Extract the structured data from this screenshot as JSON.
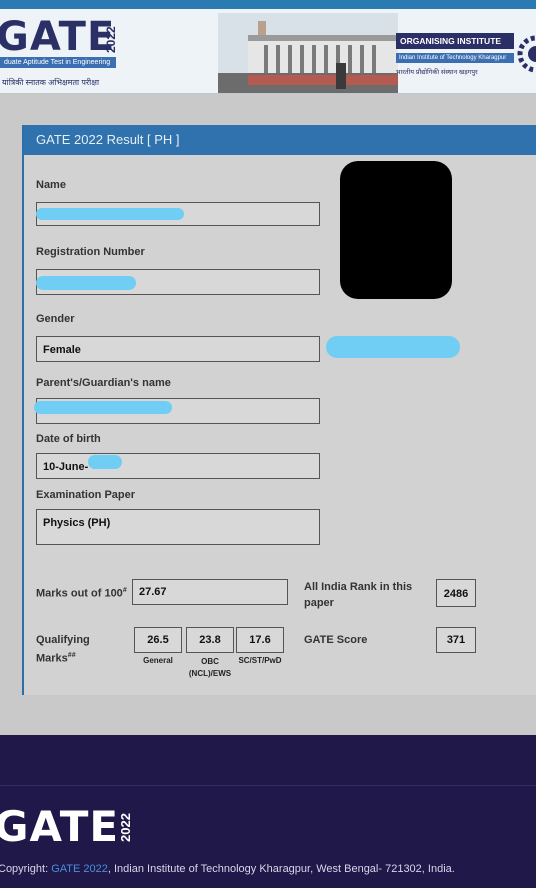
{
  "banner": {
    "logo_text": "GATE",
    "logo_year": "2022",
    "logo_subtitle": "duate Aptitude Test in Engineering",
    "logo_hindi": "यांत्रिकी स्नातक अभिक्षमता परीक्षा",
    "org_title": "ORGANISING INSTITUTE",
    "org_name": "Indian Institute of Technology Kharagpur",
    "org_hindi": "भारतीय प्रौद्योगिकी संस्थान खड़गपुर"
  },
  "result": {
    "header": "GATE 2022 Result [ PH ]",
    "name_label": "Name",
    "name_value": "",
    "reg_label": "Registration Number",
    "reg_value": "",
    "gender_label": "Gender",
    "gender_value": "Female",
    "guardian_label": "Parent's/Guardian's name",
    "guardian_value": "",
    "dob_label": "Date of birth",
    "dob_value": "10-June-",
    "paper_label": "Examination Paper",
    "paper_value": "Physics (PH)",
    "marks_label": "Marks out of 100",
    "marks_sup": "#",
    "marks_value": "27.67",
    "rank_label_1": "All India Rank in this",
    "rank_label_2": "paper",
    "rank_value": "2486",
    "qual_label_1": "Qualifying",
    "qual_label_2": "Marks",
    "qual_sup": "##",
    "qual_general": "26.5",
    "qual_general_cap": "General",
    "qual_obc": "23.8",
    "qual_obc_cap_1": "OBC",
    "qual_obc_cap_2": "(NCL)/EWS",
    "qual_sc": "17.6",
    "qual_sc_cap": "SC/ST/PwD",
    "score_label": "GATE Score",
    "score_value": "371"
  },
  "footer": {
    "logo_text": "GATE",
    "logo_year": "2022",
    "copy_prefix": "Copyright: ",
    "copy_link": "GATE 2022",
    "copy_suffix": ", Indian Institute of Technology Kharagpur, West Bengal- 721302, India."
  },
  "colors": {
    "header_blue": "#2f72ad",
    "footer_navy": "#1f1848",
    "redaction": "#70cdf3"
  }
}
